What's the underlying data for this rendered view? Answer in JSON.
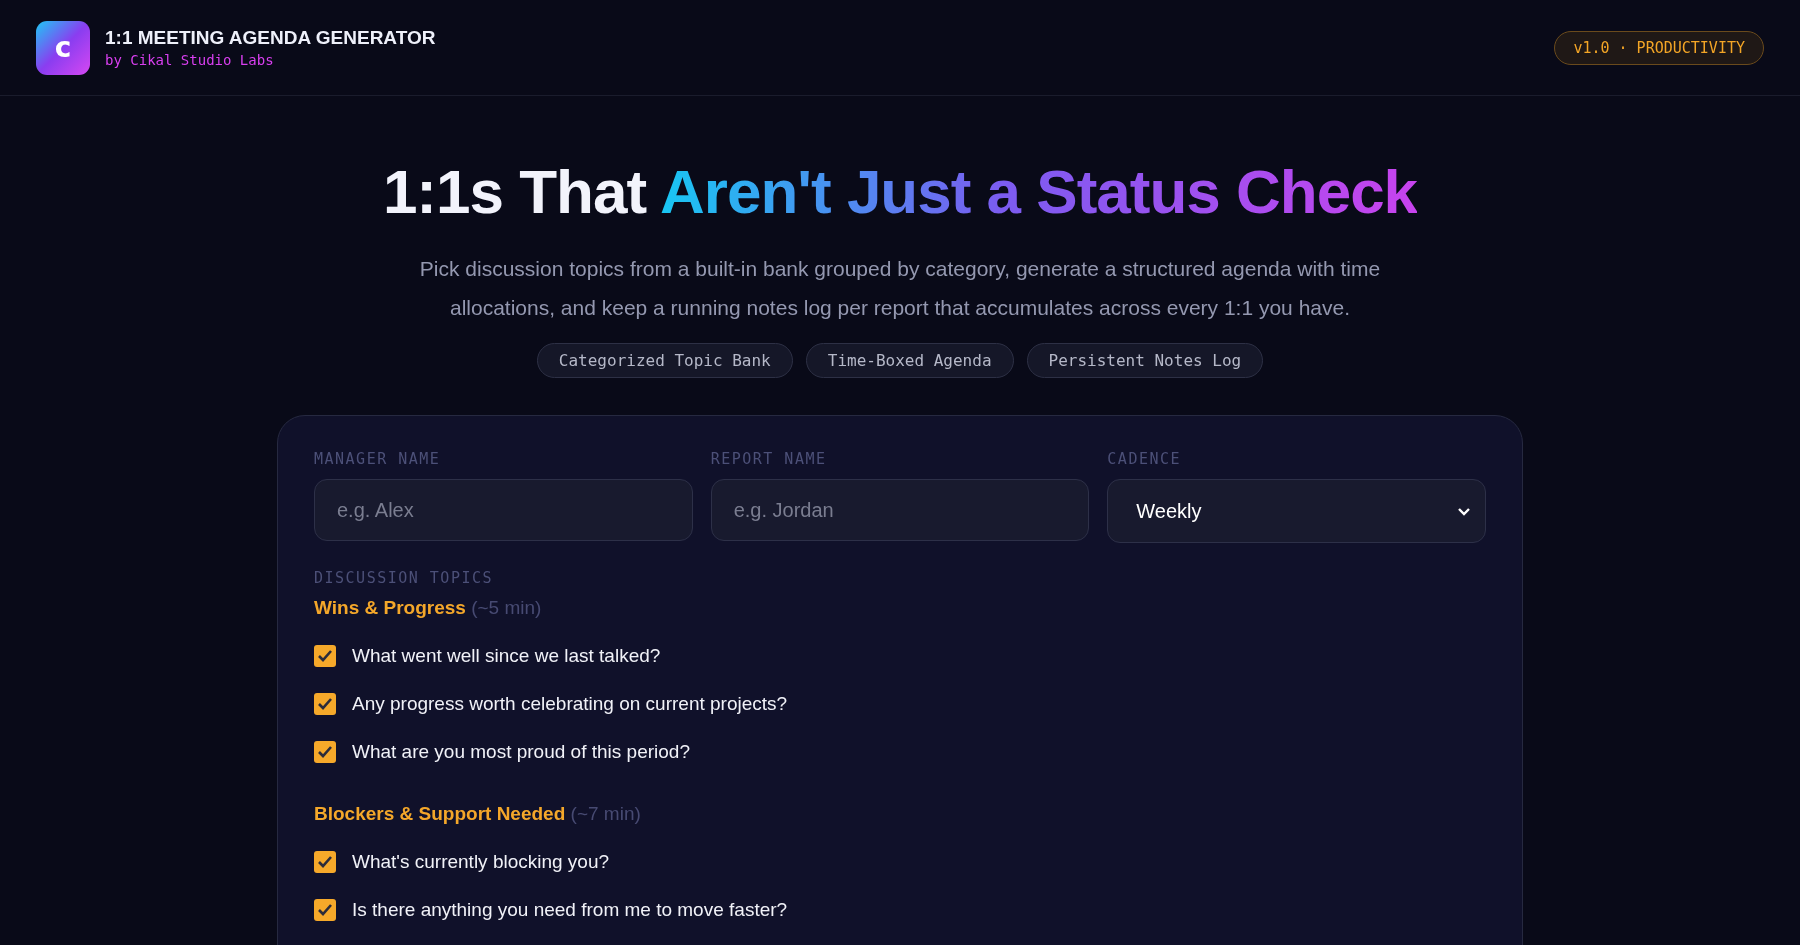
{
  "header": {
    "logo_letter": "c",
    "title": "1:1 MEETING AGENDA GENERATOR",
    "byline": "by Cikal Studio Labs",
    "badge": "v1.0 · PRODUCTIVITY"
  },
  "hero": {
    "title_plain": "1:1s That ",
    "title_highlight": "Aren't Just a Status Check",
    "subtitle": "Pick discussion topics from a built-in bank grouped by category, generate a structured agenda with time allocations, and keep a running notes log per report that accumulates across every 1:1 you have.",
    "features": [
      "Categorized Topic Bank",
      "Time-Boxed Agenda",
      "Persistent Notes Log"
    ]
  },
  "form": {
    "fields": [
      {
        "kind": "input",
        "label": "MANAGER NAME",
        "placeholder": "e.g. Alex"
      },
      {
        "kind": "input",
        "label": "REPORT NAME",
        "placeholder": "e.g. Jordan"
      },
      {
        "kind": "select",
        "label": "CADENCE",
        "value": "Weekly"
      }
    ],
    "topics_label": "DISCUSSION TOPICS",
    "groups": [
      {
        "name": "Wins & Progress",
        "time": "(~5 min)",
        "items": [
          {
            "label": "What went well since we last talked?",
            "checked": true
          },
          {
            "label": "Any progress worth celebrating on current projects?",
            "checked": true
          },
          {
            "label": "What are you most proud of this period?",
            "checked": true
          }
        ]
      },
      {
        "name": "Blockers & Support Needed",
        "time": "(~7 min)",
        "items": [
          {
            "label": "What's currently blocking you?",
            "checked": true
          },
          {
            "label": "Is there anything you need from me to move faster?",
            "checked": true
          }
        ]
      }
    ]
  }
}
